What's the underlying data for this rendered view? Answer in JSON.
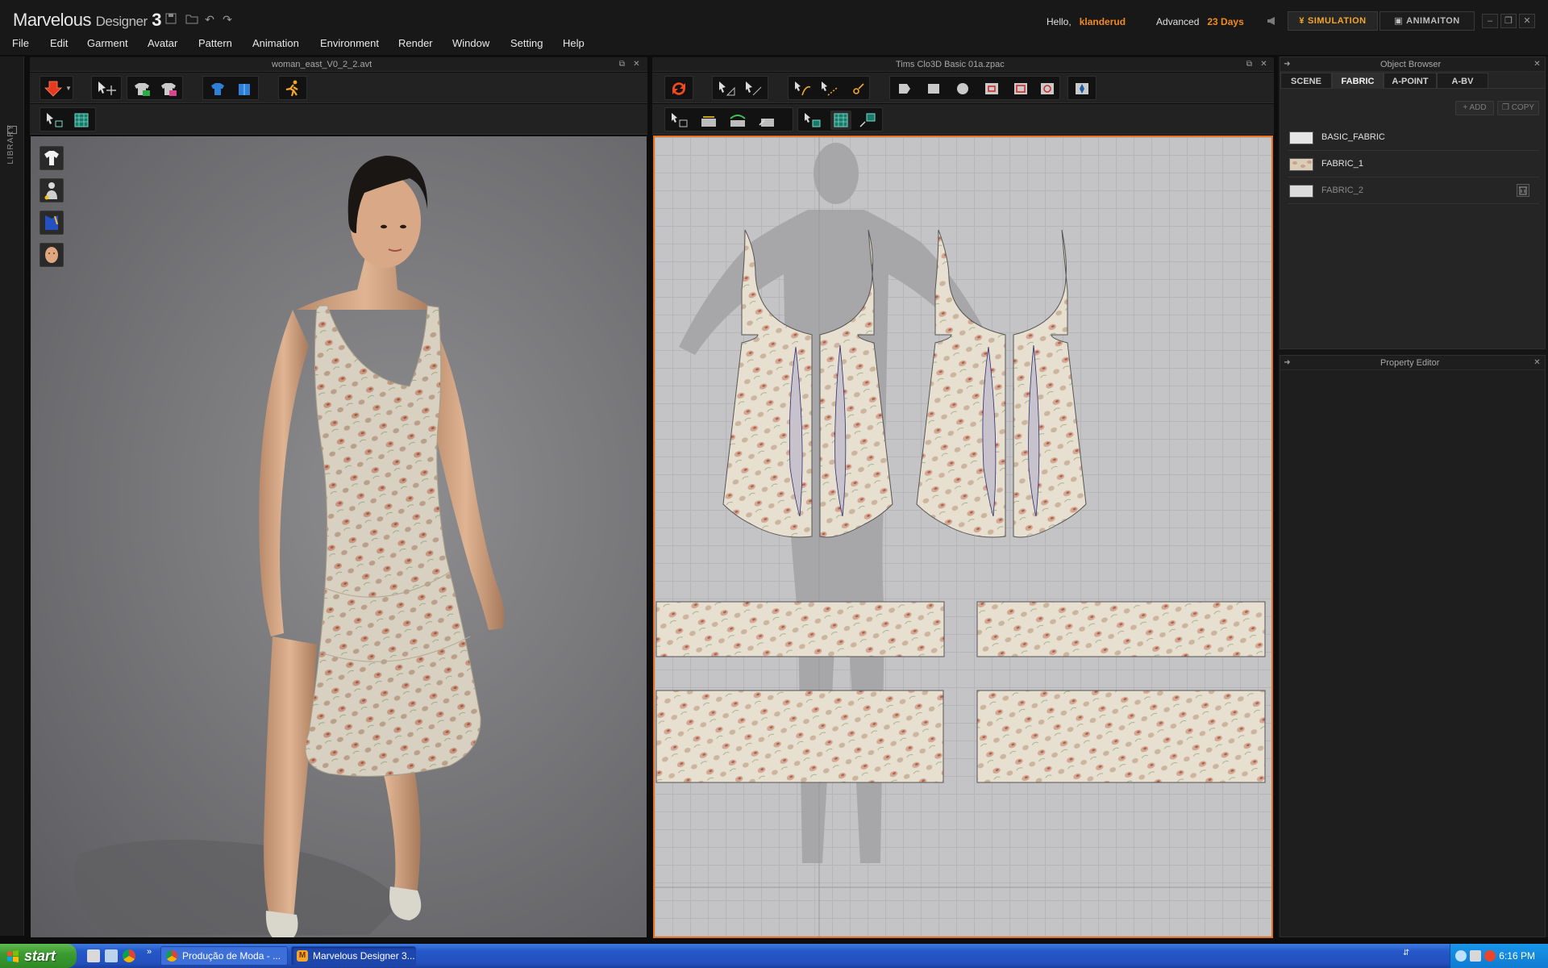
{
  "app": {
    "logo_main": "Marvelous",
    "logo_sub": "Designer",
    "logo_version": "3",
    "greeting": "Hello,",
    "username": "klanderud",
    "license": "Advanced",
    "days_left": "23 Days",
    "mode_simulation": "SIMULATION",
    "mode_animation": "ANIMAITON",
    "accent_color": "#f28a1e"
  },
  "menu": [
    "File",
    "Edit",
    "Garment",
    "Avatar",
    "Pattern",
    "Animation",
    "Environment",
    "Render",
    "Window",
    "Setting",
    "Help"
  ],
  "library": {
    "label": "LIBRARY"
  },
  "view3d": {
    "title": "woman_east_V0_2_2.avt",
    "side_tools": [
      "garment-tool",
      "avatar-tool",
      "fabric-tool",
      "head-tool"
    ]
  },
  "view2d": {
    "title": "Tims Clo3D Basic 01a.zpac"
  },
  "object_browser": {
    "title": "Object Browser",
    "tabs": [
      "SCENE",
      "FABRIC",
      "A-POINT",
      "A-BV"
    ],
    "active_tab": "FABRIC",
    "add_label": "ADD",
    "copy_label": "COPY",
    "fabrics": [
      {
        "name": "BASIC_FABRIC",
        "swatch": "#e6e6e6"
      },
      {
        "name": "FABRIC_1",
        "swatch": "#d9cdb8"
      },
      {
        "name": "FABRIC_2",
        "swatch": "#dcdcdc"
      }
    ]
  },
  "property_editor": {
    "title": "Property Editor"
  },
  "taskbar": {
    "start_label": "start",
    "tasks": [
      {
        "label": "Produção de Moda - ...",
        "active": false
      },
      {
        "label": "Marvelous Designer 3...",
        "active": true
      }
    ],
    "clock": "6:16 PM"
  }
}
